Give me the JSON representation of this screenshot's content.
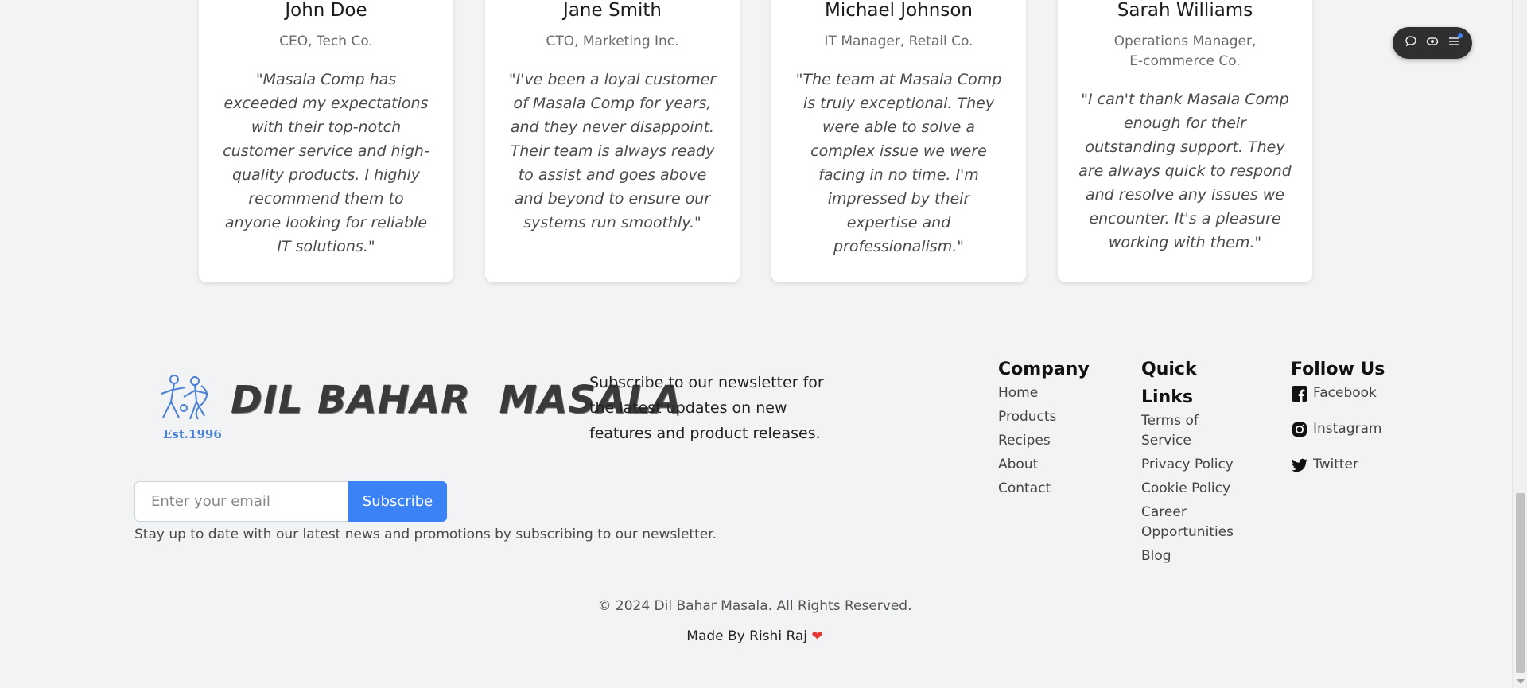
{
  "testimonials": [
    {
      "name": "John Doe",
      "role": "CEO, Tech Co.",
      "quote": "\"Masala Comp has exceeded my expectations with their top-notch customer service and high-quality products. I highly recommend them to anyone looking for reliable IT solutions.\""
    },
    {
      "name": "Jane Smith",
      "role": "CTO, Marketing Inc.",
      "quote": "\"I've been a loyal customer of Masala Comp for years, and they never disappoint. Their team is always ready to assist and goes above and beyond to ensure our systems run smoothly.\""
    },
    {
      "name": "Michael Johnson",
      "role": "IT Manager, Retail Co.",
      "quote": "\"The team at Masala Comp is truly exceptional. They were able to solve a complex issue we were facing in no time. I'm impressed by their expertise and professionalism.\""
    },
    {
      "name": "Sarah Williams",
      "role": "Operations Manager, E-commerce Co.",
      "quote": "\"I can't thank Masala Comp enough for their outstanding support. They are always quick to respond and resolve any issues we encounter. It's a pleasure working with them.\""
    }
  ],
  "logo": {
    "brand": "DIL BAHAR  MASALA",
    "est": "Est.1996"
  },
  "newsletter": {
    "text": "Subscribe to our newsletter for the latest updates on new features and product releases.",
    "placeholder": "Enter your email",
    "button": "Subscribe",
    "note": "Stay up to date with our latest news and promotions by subscribing to our newsletter."
  },
  "footer": {
    "company": {
      "title": "Company",
      "links": [
        "Home",
        "Products",
        "Recipes",
        "About",
        "Contact"
      ]
    },
    "quick": {
      "title": "Quick Links",
      "links": [
        "Terms of Service",
        "Privacy Policy",
        "Cookie Policy",
        "Career Opportunities",
        "Blog"
      ]
    },
    "follow": {
      "title": "Follow Us",
      "links": [
        "Facebook",
        "Instagram",
        "Twitter"
      ]
    },
    "copyright": "© 2024 Dil Bahar Masala. All Rights Reserved.",
    "madeby": "Made By Rishi Raj",
    "heart": "❤"
  },
  "colors": {
    "accent": "#3b82f6",
    "background": "#f2f3f5"
  }
}
